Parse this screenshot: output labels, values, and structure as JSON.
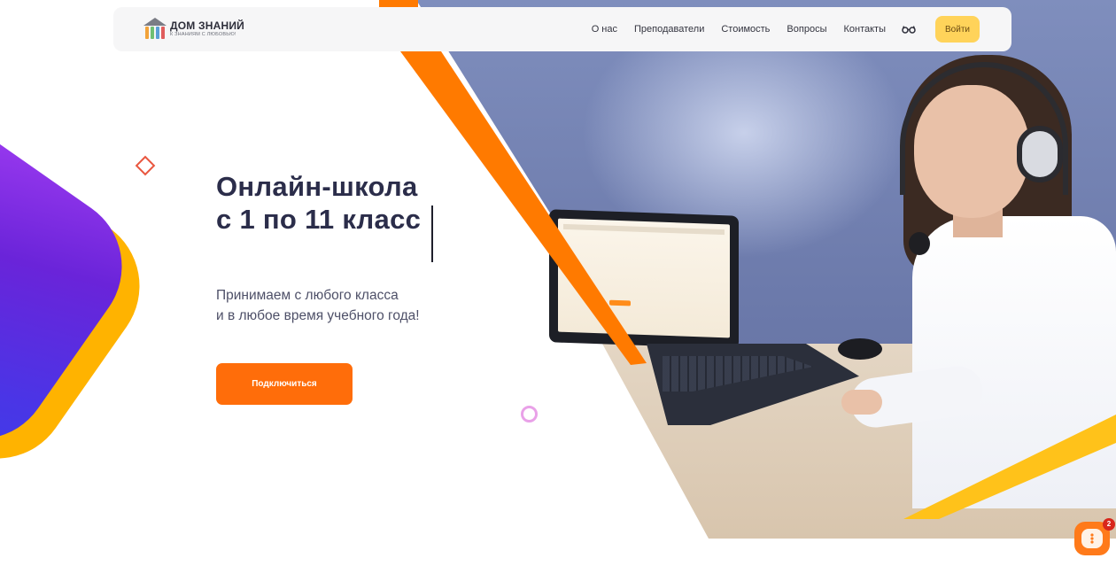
{
  "header": {
    "logo": {
      "title": "ДОМ ЗНАНИЙ",
      "tagline": "К ЗНАНИЯМ С ЛЮБОВЬЮ!",
      "icon": "school-building-icon",
      "column_colors": [
        "#f2a33a",
        "#6fbf73",
        "#5a9fd6",
        "#e05d5d"
      ]
    },
    "nav": [
      {
        "label": "О нас"
      },
      {
        "label": "Преподаватели"
      },
      {
        "label": "Стоимость"
      },
      {
        "label": "Вопросы"
      },
      {
        "label": "Контакты"
      }
    ],
    "accessibility_icon": "glasses-icon",
    "login_label": "Войти"
  },
  "hero": {
    "title_line1": "Онлайн-школа",
    "title_line2": "с 1 по 11 класс",
    "subtitle_line1": "Принимаем с любого класса",
    "subtitle_line2": "и в любое время учебного года!",
    "cta_label": "Подключиться",
    "image": "girl-with-headphones-at-laptop"
  },
  "chat_widget": {
    "icon": "chat-bubble-icon",
    "badge_count": "2"
  },
  "colors": {
    "accent_orange": "#ff6d0a",
    "login_yellow": "#ffd35a",
    "title_navy": "#2b2d4a",
    "blob_purple": "#6a24d9",
    "stripe_yellow": "#ffc21a"
  }
}
